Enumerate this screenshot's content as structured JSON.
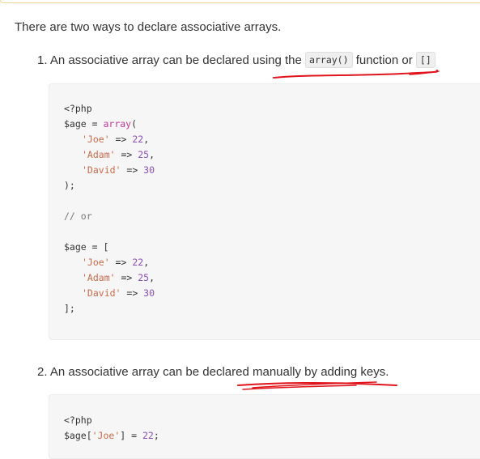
{
  "intro": "There are two ways to declare associative arrays.",
  "item1": {
    "prefix": "1. An associative array can be declared using the",
    "code_a": "array()",
    "middle": "function or",
    "code_b": "[]"
  },
  "item2": {
    "text": "2. An associative array can be declared manually by adding keys."
  },
  "block1": {
    "open": "<?php",
    "var": "$age",
    "eq": " = ",
    "fn": "array",
    "paren_open": "(",
    "entries": [
      {
        "key": "'Joe'",
        "arrow": " => ",
        "value": "22",
        "sep": ","
      },
      {
        "key": "'Adam'",
        "arrow": " => ",
        "value": "25",
        "sep": ","
      },
      {
        "key": "'David'",
        "arrow": " => ",
        "value": "30",
        "sep": ""
      }
    ],
    "close1": ");",
    "comment": "// or",
    "var2": "$age",
    "eq2": " = [",
    "entries2": [
      {
        "key": "'Joe'",
        "arrow": " => ",
        "value": "22",
        "sep": ","
      },
      {
        "key": "'Adam'",
        "arrow": " => ",
        "value": "25",
        "sep": ","
      },
      {
        "key": "'David'",
        "arrow": " => ",
        "value": "30",
        "sep": ""
      }
    ],
    "close2": "];"
  },
  "block2": {
    "open": "<?php",
    "var": "$age[",
    "key": "'Joe'",
    "rest": "] = ",
    "value": "22",
    "end": ";"
  },
  "colors": {
    "annotation": "#e0141c",
    "string": "#c86b4a",
    "keyword": "#c0399b",
    "number": "#8a4fb8"
  }
}
